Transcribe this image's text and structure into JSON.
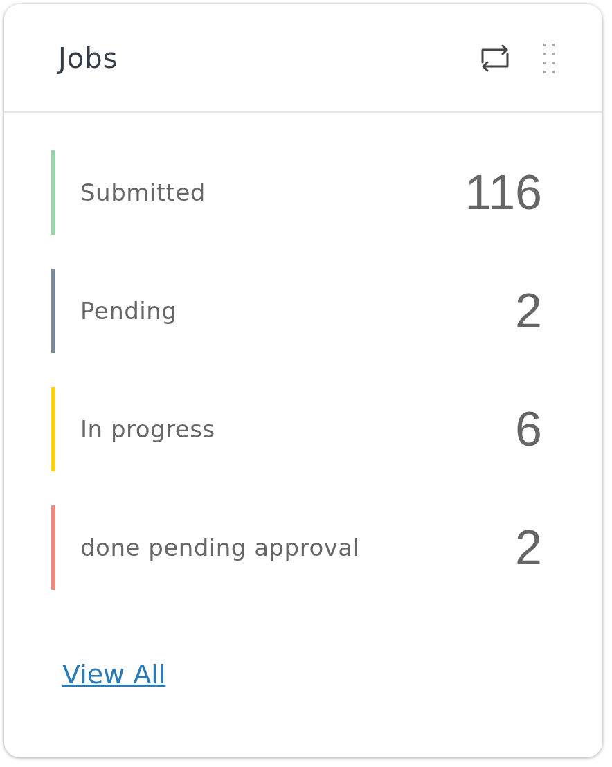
{
  "card": {
    "title": "Jobs"
  },
  "statuses": [
    {
      "label": "Submitted",
      "count": "116",
      "color": "#98d4a8"
    },
    {
      "label": "Pending",
      "count": "2",
      "color": "#7a8a99"
    },
    {
      "label": "In progress",
      "count": "6",
      "color": "#fcd116"
    },
    {
      "label": "done pending approval",
      "count": "2",
      "color": "#ee8a80"
    }
  ],
  "link": "View All"
}
